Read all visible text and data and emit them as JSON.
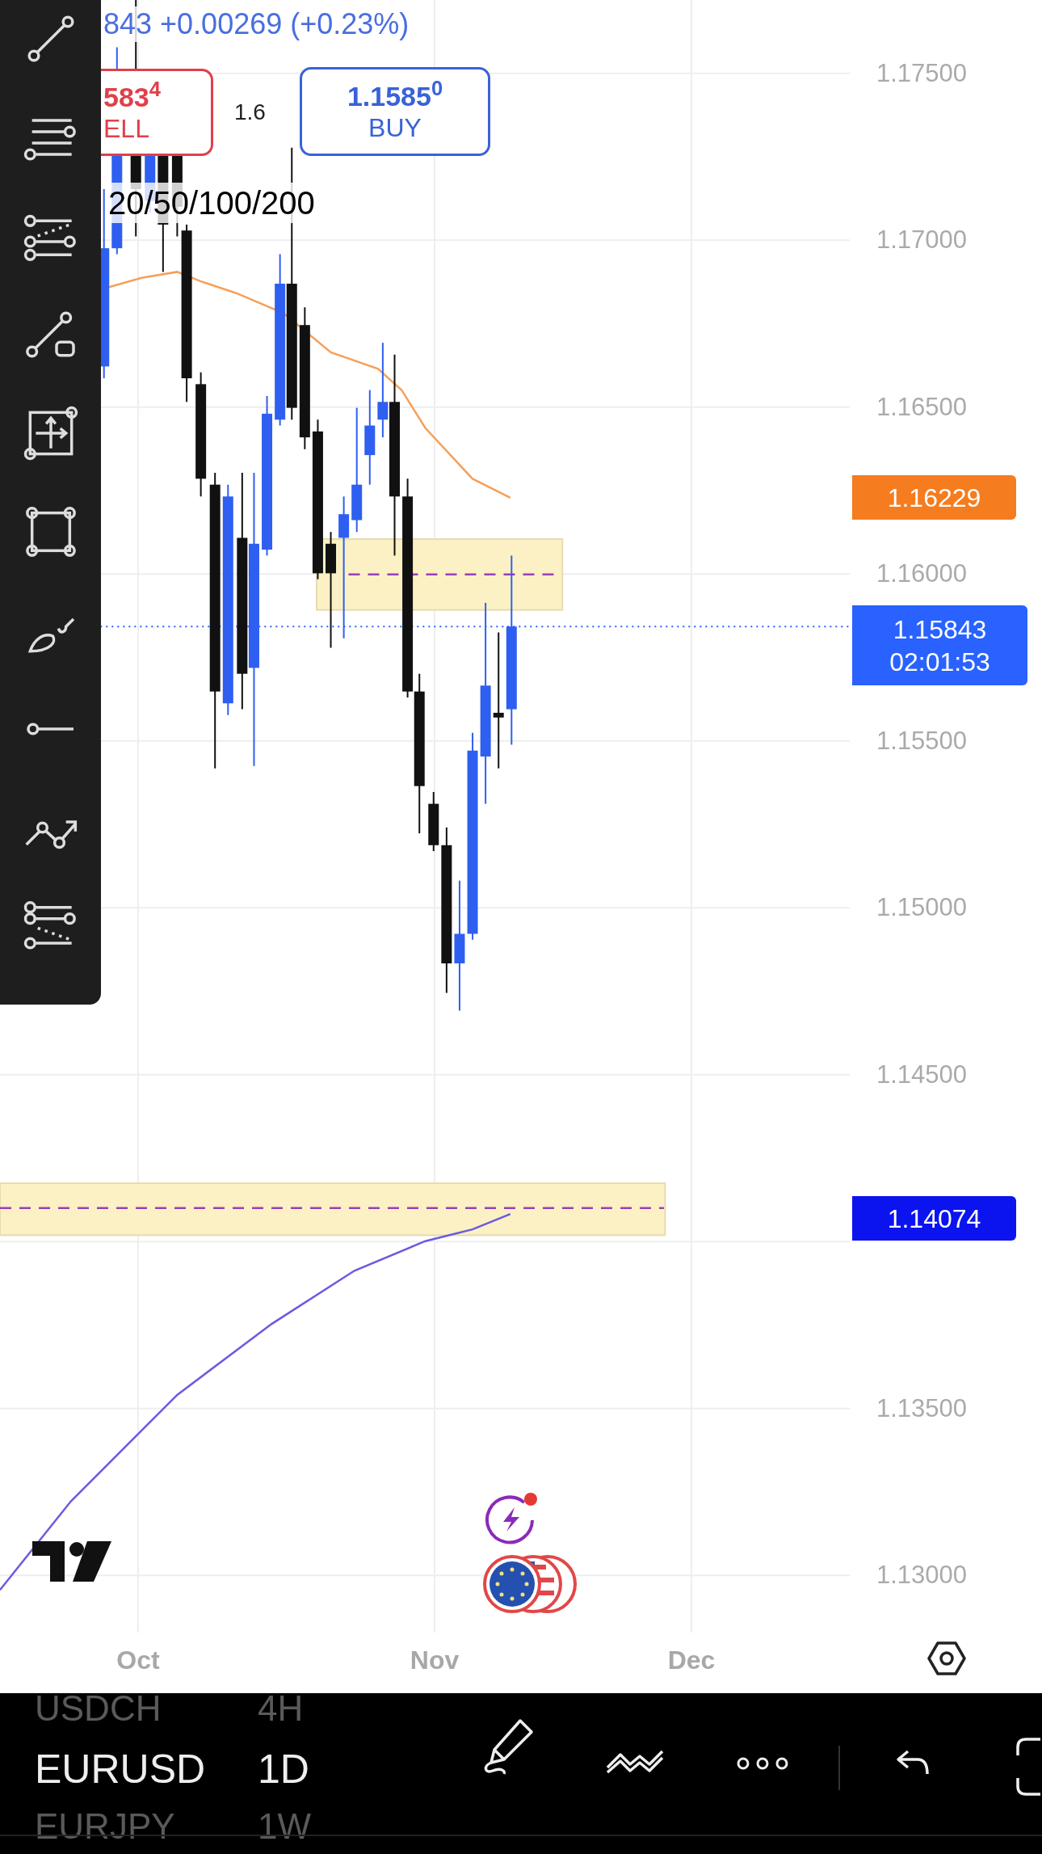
{
  "legend": {
    "price_change": "843 +0.00269 (+0.23%)"
  },
  "sell": {
    "price": "583$^{4}$",
    "label": "ELL"
  },
  "spread": "1.6",
  "buy": {
    "price": "1.1585$^{0}$",
    "label": "BUY"
  },
  "indicator_label": "20/50/100/200",
  "price_axis": [
    "1.17500",
    "1.17000",
    "1.16500",
    "1.16000",
    "1.15500",
    "1.15000",
    "1.14500",
    "1.13500",
    "1.13000"
  ],
  "price_tags": [
    {
      "kind": "average",
      "price": "1.16229",
      "color": "#f57c1f"
    },
    {
      "kind": "last",
      "price": "1.15843",
      "countdown": "02:01:53",
      "color": "#2962ff"
    },
    {
      "kind": "level",
      "price": "1.14074",
      "color": "#0b14ee"
    }
  ],
  "time_axis": [
    "Oct",
    "Nov",
    "Dec"
  ],
  "symbol_picker": [
    {
      "symbol": "USDCH",
      "interval": "4H",
      "selected": false
    },
    {
      "symbol": "EURUSD",
      "interval": "1D",
      "selected": true
    },
    {
      "symbol": "EURJPY",
      "interval": "1W",
      "selected": false
    }
  ]
}
